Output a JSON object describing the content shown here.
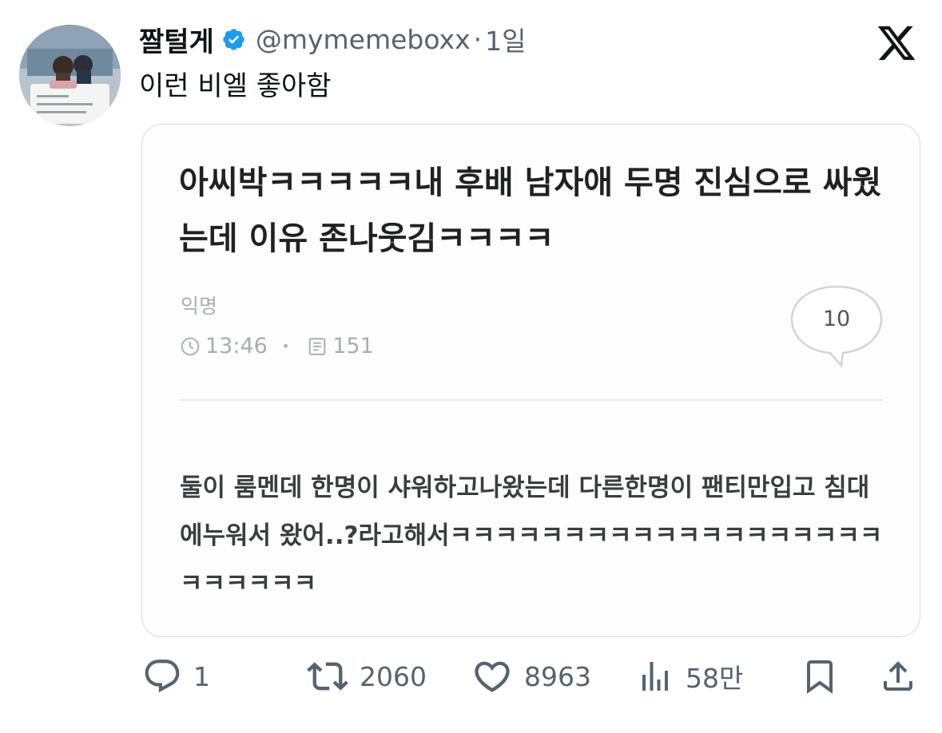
{
  "tweet": {
    "display_name": "짤털게",
    "handle": "@mymemeboxx",
    "separator": "·",
    "time": "1일",
    "text": "이런 비엘 좋아함"
  },
  "card": {
    "title": "아씨박ㅋㅋㅋㅋㅋ내 후배 남자애 두명 진심으로 싸웠는데 이유 존나웃김ㅋㅋㅋㅋ",
    "author": "익명",
    "time": "13:46",
    "views": "151",
    "comments": "10",
    "body": "둘이 룸멘데 한명이 샤워하고나왔는데 다른한명이 팬티만입고 침대에누워서 왔어..?라고해서ㅋㅋㅋㅋㅋㅋㅋㅋㅋㅋㅋㅋㅋㅋㅋㅋㅋㅋㅋㅋㅋㅋㅋㅋㅋ"
  },
  "actions": {
    "reply": {
      "icon": "reply-icon",
      "count": "1"
    },
    "retweet": {
      "icon": "retweet-icon",
      "count": "2060"
    },
    "like": {
      "icon": "heart-icon",
      "count": "8963"
    },
    "views": {
      "icon": "bar-chart-icon",
      "count": "58만"
    },
    "bookmark": {
      "icon": "bookmark-icon"
    },
    "share": {
      "icon": "share-icon"
    }
  },
  "colors": {
    "verified": "#1d9bf0",
    "secondary_text": "#536471",
    "card_border": "#d6dbe0"
  }
}
